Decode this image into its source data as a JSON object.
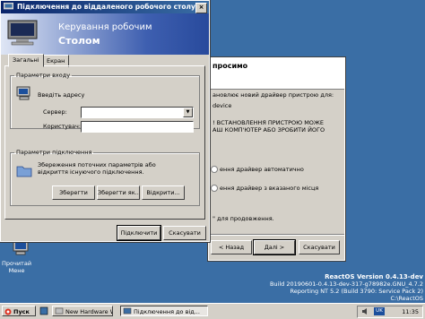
{
  "desktop": {
    "icon_label": "Прочитай\nМене",
    "os_info": {
      "version": "ReactOS Version 0.4.13-dev",
      "build": "Build 20190601-0.4.13-dev-317-g78982e.GNU_4.7.2",
      "reporting": "Reporting NT 5.2 (Build 3790: Service Pack 2)",
      "path": "C:\\ReactOS"
    }
  },
  "wizard": {
    "title_partial": "просимо",
    "lines": [
      "ановлює новий драйвер пристрою для:",
      "device",
      "! ВСТАНОВЛЕННЯ ПРИСТРОЮ МОЖЕ",
      "АШ КОМП'ЮТЕР АБО ЗРОБИТИ ЙОГО"
    ],
    "option_auto": "ення драйвер автоматично",
    "option_manual": "ення драйвер з вказаного місця",
    "continue_hint": "\" для продовження.",
    "buttons": {
      "back": "< Назад",
      "next": "Далі >",
      "cancel": "Скасувати"
    }
  },
  "rdp": {
    "title": "Підключення до віддаленого робочого столу",
    "banner_line1": "Керування робочим",
    "banner_line2": "Столом",
    "tabs": [
      "Загальні",
      "Екран"
    ],
    "logon": {
      "legend": "Параметри входу",
      "hint": "Введіть адресу",
      "server_label": "Сервер:",
      "server_value": "",
      "user_label": "Користувач:",
      "user_value": ""
    },
    "connection": {
      "legend": "Параметри підключення",
      "description": "Збереження поточних параметрів або відкриття існуючого підключення.",
      "save": "Зберегти",
      "save_as": "Зберегти як...",
      "open": "Відкрити..."
    },
    "connect": "Підключити",
    "cancel": "Скасувати"
  },
  "taskbar": {
    "start": "Пуск",
    "tasks": [
      "New Hardware Wizard",
      "Підключення до від..."
    ],
    "lang": "UK",
    "clock": "11:35"
  }
}
